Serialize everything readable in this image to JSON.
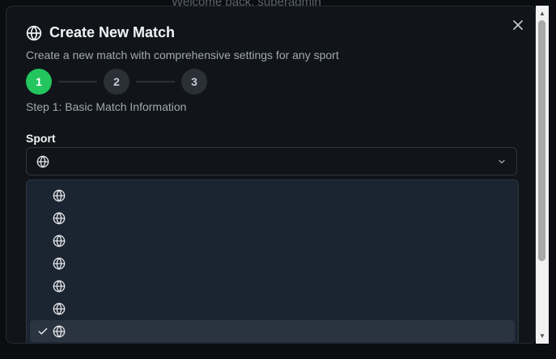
{
  "backdrop": {
    "text": "Welcome back, superadmin"
  },
  "dialog": {
    "title": "Create New Match",
    "title_icon": "globe-icon",
    "subtitle": "Create a new match with comprehensive settings for any sport",
    "close_icon": "close-icon"
  },
  "stepper": {
    "steps": [
      {
        "label": "1",
        "state": "active"
      },
      {
        "label": "2",
        "state": "inactive"
      },
      {
        "label": "3",
        "state": "inactive"
      }
    ],
    "caption": "Step 1: Basic Match Information"
  },
  "sport_field": {
    "label": "Sport",
    "selected_icon": "globe-icon",
    "chevron_icon": "chevron-down-icon"
  },
  "sport_options": [
    {
      "icon": "globe-icon",
      "selected": false
    },
    {
      "icon": "globe-icon",
      "selected": false
    },
    {
      "icon": "globe-icon",
      "selected": false
    },
    {
      "icon": "globe-icon",
      "selected": false
    },
    {
      "icon": "globe-icon",
      "selected": false
    },
    {
      "icon": "globe-icon",
      "selected": false
    },
    {
      "icon": "globe-icon",
      "selected": true
    }
  ],
  "colors": {
    "accent": "#22c55e",
    "dialog_bg": "#111519",
    "dropdown_bg": "#1b2532",
    "selected_option_bg": "#2a3440"
  }
}
